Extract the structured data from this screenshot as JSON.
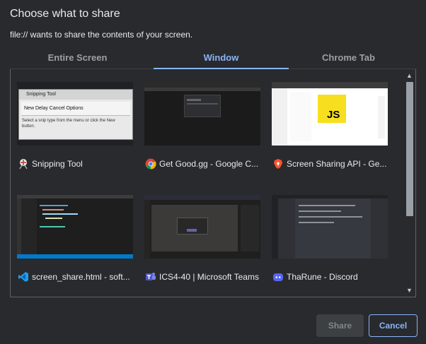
{
  "dialog": {
    "title": "Choose what to share",
    "subtitle": "file:// wants to share the contents of your screen."
  },
  "tabs": [
    {
      "label": "Entire Screen",
      "active": false
    },
    {
      "label": "Window",
      "active": true
    },
    {
      "label": "Chrome Tab",
      "active": false
    }
  ],
  "windows": [
    {
      "label": "Snipping Tool",
      "icon": "snipping-tool-icon"
    },
    {
      "label": "Get Good.gg - Google C...",
      "icon": "chrome-icon"
    },
    {
      "label": "Screen Sharing API - Ge...",
      "icon": "brave-icon"
    },
    {
      "label": "screen_share.html - soft...",
      "icon": "vscode-icon"
    },
    {
      "label": "ICS4-40 | Microsoft Teams",
      "icon": "teams-icon"
    },
    {
      "label": "ThaRune - Discord",
      "icon": "discord-icon"
    }
  ],
  "snip_thumb": {
    "title": "Snipping Tool",
    "toolbar": "New  Delay  Cancel  Options",
    "hint": "Select a snip type from the menu or click the New button."
  },
  "js_badge": "JS",
  "buttons": {
    "share": "Share",
    "cancel": "Cancel"
  },
  "scroll": {
    "up": "▲",
    "down": "▼"
  },
  "colors": {
    "accent": "#8ab4f8",
    "background": "#292a2d",
    "text": "#e8eaed",
    "muted": "#9aa0a6"
  }
}
